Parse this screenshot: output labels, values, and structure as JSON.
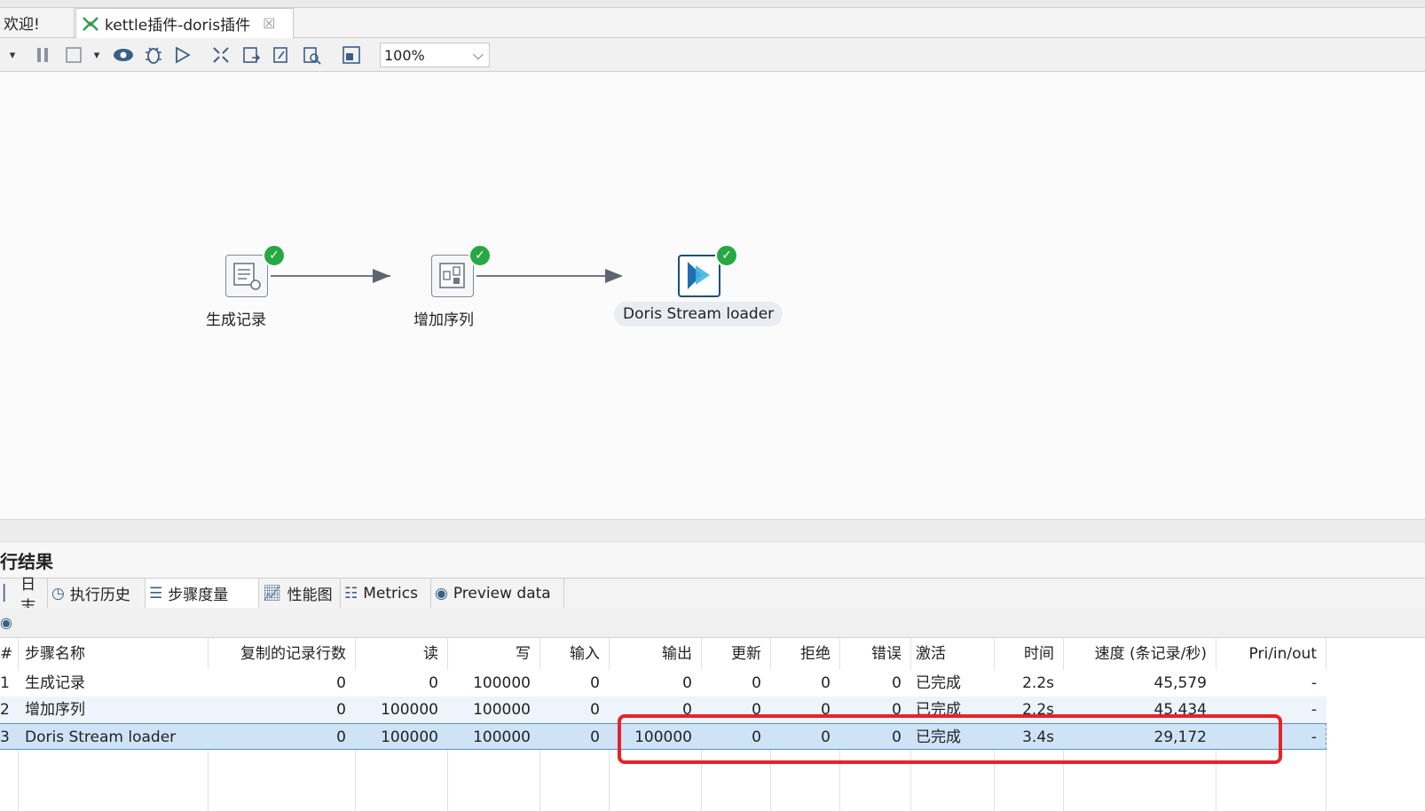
{
  "tabs": {
    "welcome": "欢迎!",
    "active": "kettle插件-doris插件"
  },
  "toolbar": {
    "zoom": "100%",
    "icons": [
      "run-icon",
      "pause-icon",
      "stop-icon",
      "preview-icon",
      "debug-icon",
      "replay-icon",
      "verify-icon",
      "impact-icon",
      "sql-icon",
      "explore-db-icon",
      "show-results-icon"
    ]
  },
  "canvas": {
    "steps": [
      {
        "name": "生成记录",
        "status": "ok"
      },
      {
        "name": "增加序列",
        "status": "ok"
      },
      {
        "name": "Doris Stream loader",
        "status": "ok"
      }
    ]
  },
  "results": {
    "title": "行结果",
    "tabs": [
      {
        "label": "日志",
        "icon": "log-icon"
      },
      {
        "label": "执行历史",
        "icon": "history-icon"
      },
      {
        "label": "步骤度量",
        "icon": "metrics-list-icon"
      },
      {
        "label": "性能图",
        "icon": "perf-graph-icon"
      },
      {
        "label": "Metrics",
        "icon": "metrics-icon"
      },
      {
        "label": "Preview data",
        "icon": "preview-data-icon"
      }
    ],
    "active_tab": "步骤度量",
    "columns": [
      "#",
      "步骤名称",
      "复制的记录行数",
      "读",
      "写",
      "输入",
      "输出",
      "更新",
      "拒绝",
      "错误",
      "激活",
      "时间",
      "速度 (条记录/秒)",
      "Pri/in/out"
    ],
    "rows": [
      [
        "1",
        "生成记录",
        "0",
        "0",
        "100000",
        "0",
        "0",
        "0",
        "0",
        "0",
        "已完成",
        "2.2s",
        "45,579",
        "-"
      ],
      [
        "2",
        "增加序列",
        "0",
        "100000",
        "100000",
        "0",
        "0",
        "0",
        "0",
        "0",
        "已完成",
        "2.2s",
        "45,434",
        "-"
      ],
      [
        "3",
        "Doris Stream loader",
        "0",
        "100000",
        "100000",
        "0",
        "100000",
        "0",
        "0",
        "0",
        "已完成",
        "3.4s",
        "29,172",
        "-"
      ]
    ]
  }
}
